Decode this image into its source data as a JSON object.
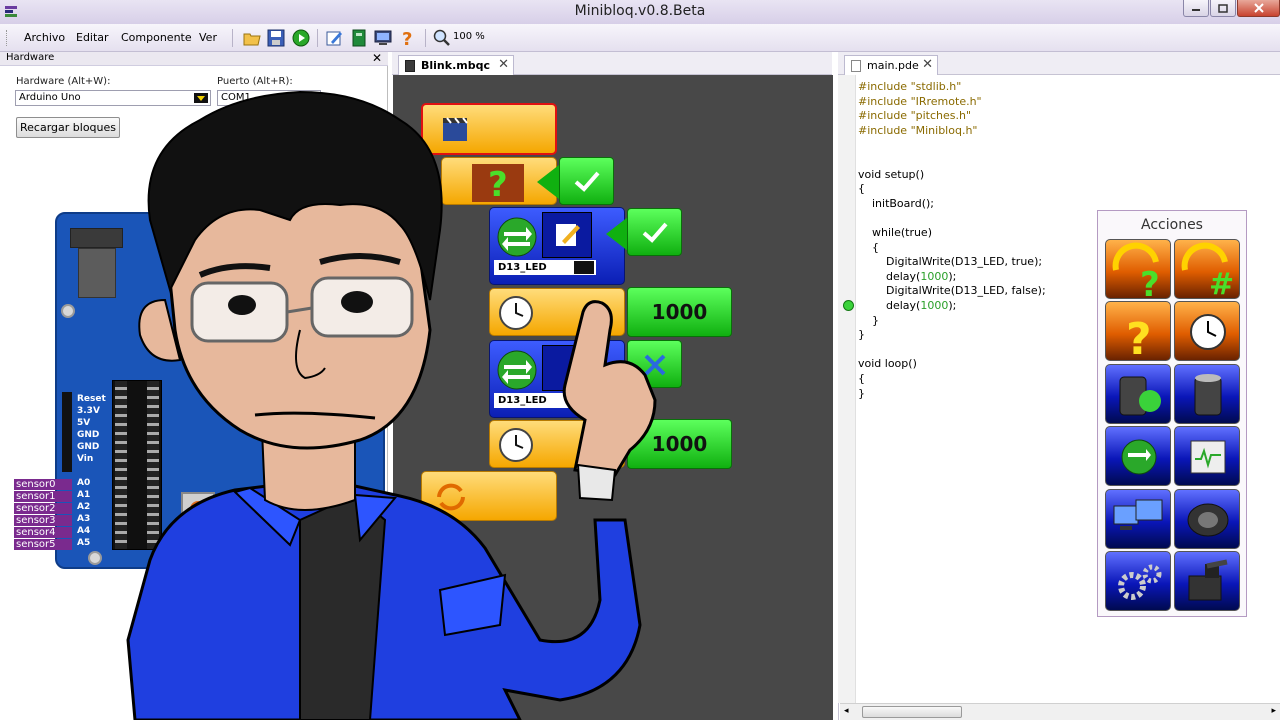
{
  "window": {
    "title": "Minibloq.v0.8.Beta"
  },
  "menu": {
    "items": [
      "Archivo",
      "Editar",
      "Componente",
      "Ver"
    ]
  },
  "toolbar": {
    "zoom": "100 %"
  },
  "hardware_panel": {
    "title": "Hardware",
    "hardware_label": "Hardware (Alt+W):",
    "hardware_value": "Arduino Uno",
    "port_label": "Puerto (Alt+R):",
    "port_value": "COM1",
    "reload_button": "Recargar bloques",
    "power_pins": [
      "Reset",
      "3.3V",
      "5V",
      "GND",
      "GND",
      "Vin"
    ],
    "analog_pins": [
      "A0",
      "A1",
      "A2",
      "A3",
      "A4",
      "A5"
    ],
    "sensors": [
      "sensor0",
      "sensor1",
      "sensor2",
      "sensor3",
      "sensor4",
      "sensor5"
    ]
  },
  "block_editor": {
    "tab_label": "Blink.mbqc",
    "pin1_label": "D13_LED",
    "pin2_label": "D13_LED",
    "delay1_value": "1000",
    "delay2_value": "1000"
  },
  "code_editor": {
    "tab_label": "main.pde",
    "lines": [
      {
        "text": "#include \"stdlib.h\"",
        "cls": "kw-inc"
      },
      {
        "text": "#include \"IRremote.h\"",
        "cls": "kw-inc"
      },
      {
        "text": "#include \"pitches.h\"",
        "cls": "kw-inc"
      },
      {
        "text": "#include \"Minibloq.h\"",
        "cls": "kw-inc"
      },
      {
        "text": "",
        "cls": ""
      },
      {
        "text": "",
        "cls": ""
      },
      {
        "text": "void setup()",
        "cls": ""
      },
      {
        "text": "{",
        "cls": ""
      },
      {
        "text": "    initBoard();",
        "cls": ""
      },
      {
        "text": "",
        "cls": ""
      },
      {
        "text": "    while(true)",
        "cls": ""
      },
      {
        "text": "    {",
        "cls": ""
      },
      {
        "text": "        DigitalWrite(D13_LED, true);",
        "cls": ""
      },
      {
        "text": "        delay(1000);",
        "cls": "delay"
      },
      {
        "text": "        DigitalWrite(D13_LED, false);",
        "cls": ""
      },
      {
        "text": "        delay(1000);",
        "cls": "delay"
      },
      {
        "text": "    }",
        "cls": ""
      },
      {
        "text": "}",
        "cls": ""
      },
      {
        "text": "",
        "cls": ""
      },
      {
        "text": "void loop()",
        "cls": ""
      },
      {
        "text": "{",
        "cls": ""
      },
      {
        "text": "}",
        "cls": ""
      }
    ]
  },
  "acciones": {
    "title": "Acciones",
    "items": [
      {
        "icon": "loop-condition-icon",
        "color": "orange"
      },
      {
        "icon": "loop-count-icon",
        "color": "orange"
      },
      {
        "icon": "if-question-icon",
        "color": "orange"
      },
      {
        "icon": "delay-clock-icon",
        "color": "orange"
      },
      {
        "icon": "variable-init-icon",
        "color": "blue"
      },
      {
        "icon": "variable-set-icon",
        "color": "blue"
      },
      {
        "icon": "digital-write-icon",
        "color": "blue"
      },
      {
        "icon": "analog-write-icon",
        "color": "blue"
      },
      {
        "icon": "serial-monitor-icon",
        "color": "blue"
      },
      {
        "icon": "speaker-icon",
        "color": "blue"
      },
      {
        "icon": "motor-gears-icon",
        "color": "blue"
      },
      {
        "icon": "servo-icon",
        "color": "blue"
      }
    ]
  },
  "colors": {
    "titlebar": "#d7cfe8",
    "canvas": "#484848",
    "block_orange": "#f5a700",
    "block_blue": "#0b1fb5",
    "block_green": "#10b010",
    "board": "#1a55b8",
    "shirt": "#1f3fe0"
  }
}
